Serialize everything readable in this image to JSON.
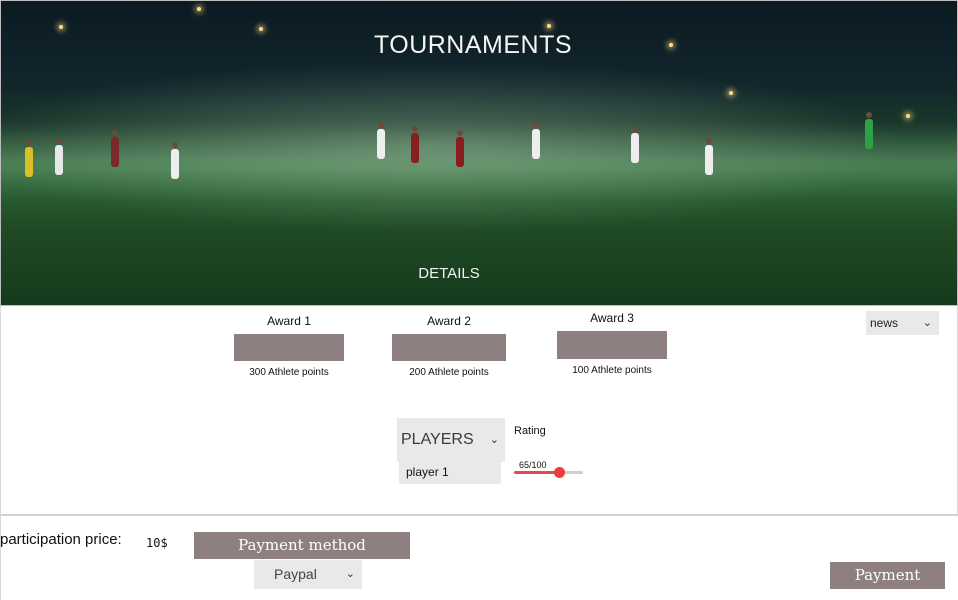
{
  "hero": {
    "title": "TOURNAMENTS",
    "details_label": "DETAILS",
    "image": "night-football-match-photo"
  },
  "awards": [
    {
      "title": "Award 1",
      "points": "300 Athlete points"
    },
    {
      "title": "Award 2",
      "points": "200 Athlete points"
    },
    {
      "title": "Award 3",
      "points": "100 Athlete points"
    }
  ],
  "news_select": {
    "value": "news",
    "icon": "chevron-down-icon"
  },
  "players": {
    "select_label": "PLAYERS",
    "first_player": "player 1",
    "icon": "chevron-down-icon"
  },
  "rating": {
    "label": "Rating",
    "value_text": "65/100",
    "value": 65,
    "max": 100,
    "accent": "#e84a4a"
  },
  "payment": {
    "price_label": "participation price:",
    "price_value": "10$",
    "method_label": "Payment method",
    "method_value": "Paypal",
    "pay_button": "Payment",
    "button_color": "#8e8080"
  }
}
